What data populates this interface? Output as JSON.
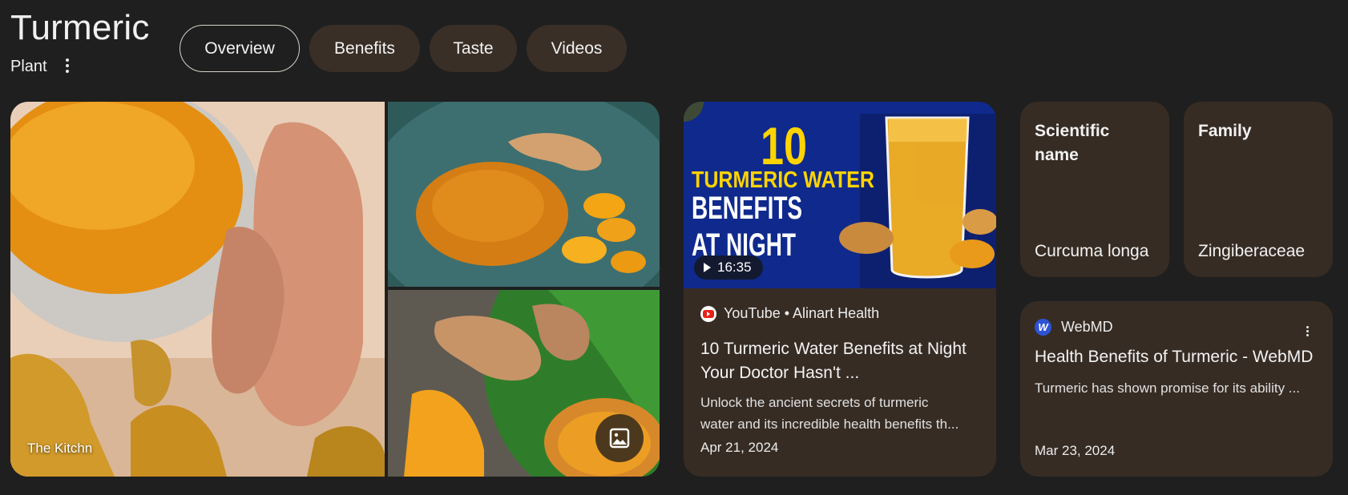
{
  "header": {
    "title": "Turmeric",
    "subtitle": "Plant"
  },
  "tabs": [
    {
      "label": "Overview",
      "active": true
    },
    {
      "label": "Benefits",
      "active": false
    },
    {
      "label": "Taste",
      "active": false
    },
    {
      "label": "Videos",
      "active": false
    }
  ],
  "images": {
    "main_source": "The Kitchn",
    "more_images_icon": "image-icon"
  },
  "video": {
    "thumbnail_text": [
      "10",
      "TURMERIC WATER",
      "BENEFITS",
      "AT NIGHT"
    ],
    "duration": "16:35",
    "source": "YouTube • Alinart Health",
    "title_lines": [
      "10 Turmeric Water Benefits at Night",
      "Your Doctor Hasn't ..."
    ],
    "desc_lines": [
      "Unlock the ancient secrets of turmeric",
      "water and its incredible health benefits th..."
    ],
    "date": "Apr 21, 2024"
  },
  "facts": [
    {
      "label": "Scientific name",
      "value": "Curcuma longa"
    },
    {
      "label": "Family",
      "value": "Zingiberaceae"
    }
  ],
  "article": {
    "source": "WebMD",
    "logo_letter": "W",
    "title": "Health Benefits of Turmeric - WebMD",
    "desc": "Turmeric has shown promise for its ability ...",
    "date": "Mar 23, 2024"
  },
  "colors": {
    "background": "#1f1f1f",
    "card": "#362c24",
    "chip": "#3a2f27",
    "turmeric": "#e89a1c",
    "youtube_red": "#e62117",
    "webmd_blue": "#2d54d6"
  }
}
